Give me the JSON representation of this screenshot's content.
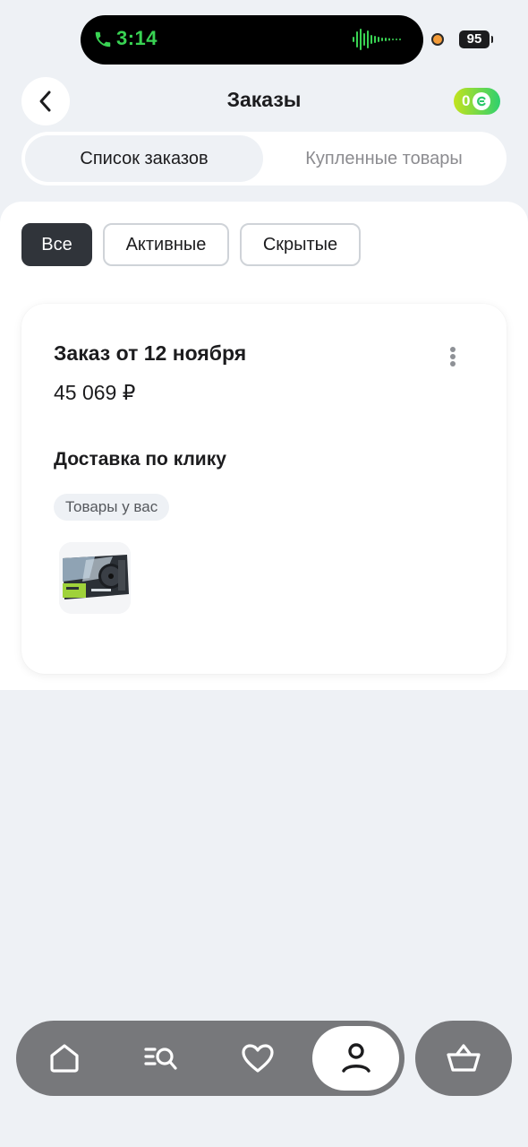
{
  "status_bar": {
    "time": "3:14",
    "battery": "95"
  },
  "header": {
    "title": "Заказы",
    "bonus_count": "0"
  },
  "segmented": {
    "tabs": [
      {
        "label": "Список заказов",
        "active": true
      },
      {
        "label": "Купленные товары",
        "active": false
      }
    ]
  },
  "filters": [
    {
      "label": "Все",
      "active": true
    },
    {
      "label": "Активные",
      "active": false
    },
    {
      "label": "Скрытые",
      "active": false
    }
  ],
  "order": {
    "title": "Заказ от 12 ноября",
    "price": "45 069 ₽",
    "delivery": "Доставка по клику",
    "status": "Товары у вас"
  },
  "colors": {
    "accent_green": "#39d353",
    "chip_active": "#30343a",
    "nav_bg": "#77787b",
    "background": "#eef1f5"
  },
  "nav": {
    "items": [
      {
        "icon": "home-icon",
        "active": false
      },
      {
        "icon": "catalog-search-icon",
        "active": false
      },
      {
        "icon": "heart-icon",
        "active": false
      },
      {
        "icon": "profile-icon",
        "active": true
      }
    ],
    "cart_icon": "basket-icon"
  }
}
